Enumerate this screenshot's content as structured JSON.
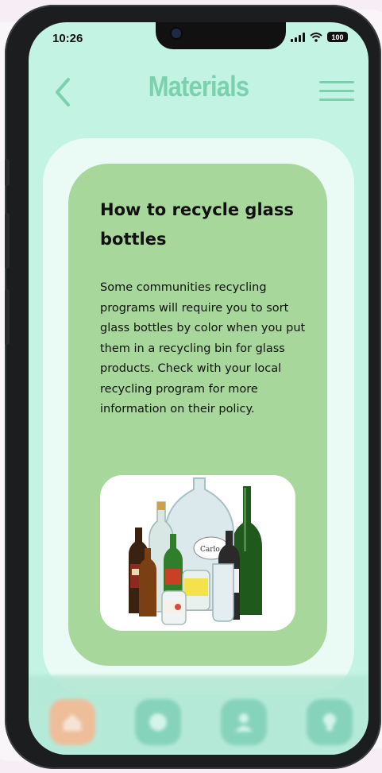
{
  "status": {
    "time": "10:26",
    "battery": "100"
  },
  "header": {
    "title": "Materials"
  },
  "card": {
    "title": "How to recycle glass bottles",
    "body": "Some communities recycling programs will require you to sort glass bottles by color when you put them in a recycling bin for glass products. Check with your local recycling program for more information on their policy."
  },
  "nav": {
    "items": [
      {
        "icon": "home-icon",
        "active": true,
        "color": "#f3b993"
      },
      {
        "icon": "compass-icon",
        "active": false,
        "color": "#7fd0b6"
      },
      {
        "icon": "user-icon",
        "active": false,
        "color": "#7fd0b6"
      },
      {
        "icon": "lightbulb-icon",
        "active": false,
        "color": "#7fd0b6"
      }
    ]
  },
  "colors": {
    "accent": "#7ad1ad",
    "background": "#c3f3e3",
    "card": "#a7d79a"
  }
}
